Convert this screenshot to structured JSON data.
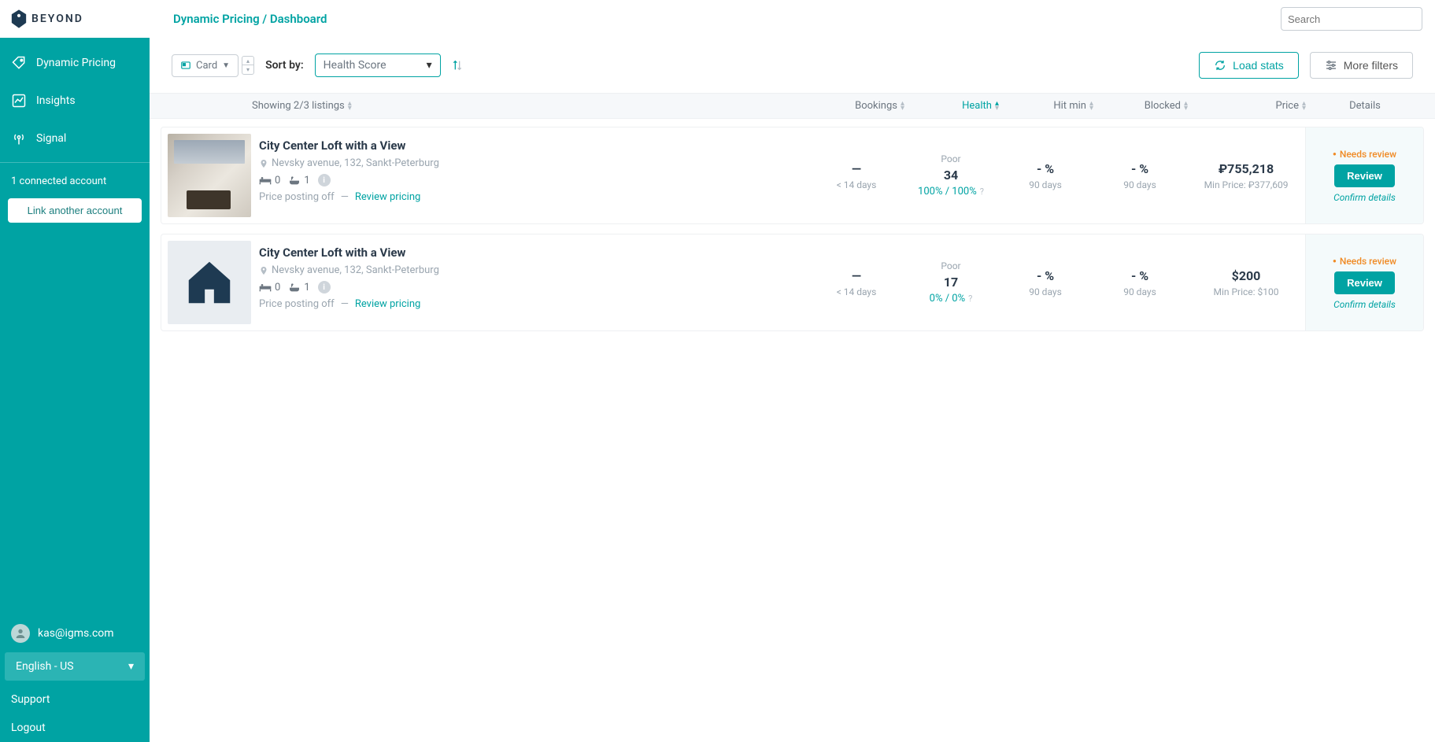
{
  "logo_text": "BEYOND",
  "breadcrumb": "Dynamic Pricing / Dashboard",
  "search_placeholder": "Search",
  "sidebar": {
    "nav": [
      {
        "label": "Dynamic Pricing"
      },
      {
        "label": "Insights"
      },
      {
        "label": "Signal"
      }
    ],
    "connected": "1 connected account",
    "link_another": "Link another account",
    "user_email": "kas@igms.com",
    "language": "English - US",
    "support": "Support",
    "logout": "Logout"
  },
  "controls": {
    "view_label": "Card",
    "sort_by_label": "Sort by:",
    "sort_value": "Health Score",
    "load_stats": "Load stats",
    "more_filters": "More filters"
  },
  "table": {
    "showing": "Showing 2/3 listings",
    "cols": {
      "bookings": "Bookings",
      "health": "Health",
      "hit_min": "Hit min",
      "blocked": "Blocked",
      "price": "Price",
      "details": "Details"
    }
  },
  "listings": [
    {
      "thumb_type": "photo",
      "title": "City Center Loft with a View",
      "address": "Nevsky avenue, 132, Sankt-Peterburg",
      "beds": "0",
      "baths": "1",
      "price_posting": "Price posting off",
      "review_pricing": "Review pricing",
      "bookings_value": "—",
      "bookings_sub": "< 14 days",
      "health_lbl": "Poor",
      "health_value": "34",
      "health_sub": "100% / 100%",
      "hitmin_value": "- %",
      "hitmin_sub": "90 days",
      "blocked_value": "- %",
      "blocked_sub": "90 days",
      "price_value": "₽755,218",
      "price_sub": "Min Price: ₽377,609",
      "needs_review": "Needs review",
      "review_btn": "Review",
      "confirm": "Confirm details"
    },
    {
      "thumb_type": "icon",
      "title": "City Center Loft with a View",
      "address": "Nevsky avenue, 132, Sankt-Peterburg",
      "beds": "0",
      "baths": "1",
      "price_posting": "Price posting off",
      "review_pricing": "Review pricing",
      "bookings_value": "—",
      "bookings_sub": "< 14 days",
      "health_lbl": "Poor",
      "health_value": "17",
      "health_sub": "0% / 0%",
      "hitmin_value": "- %",
      "hitmin_sub": "90 days",
      "blocked_value": "- %",
      "blocked_sub": "90 days",
      "price_value": "$200",
      "price_sub": "Min Price: $100",
      "needs_review": "Needs review",
      "review_btn": "Review",
      "confirm": "Confirm details"
    }
  ]
}
